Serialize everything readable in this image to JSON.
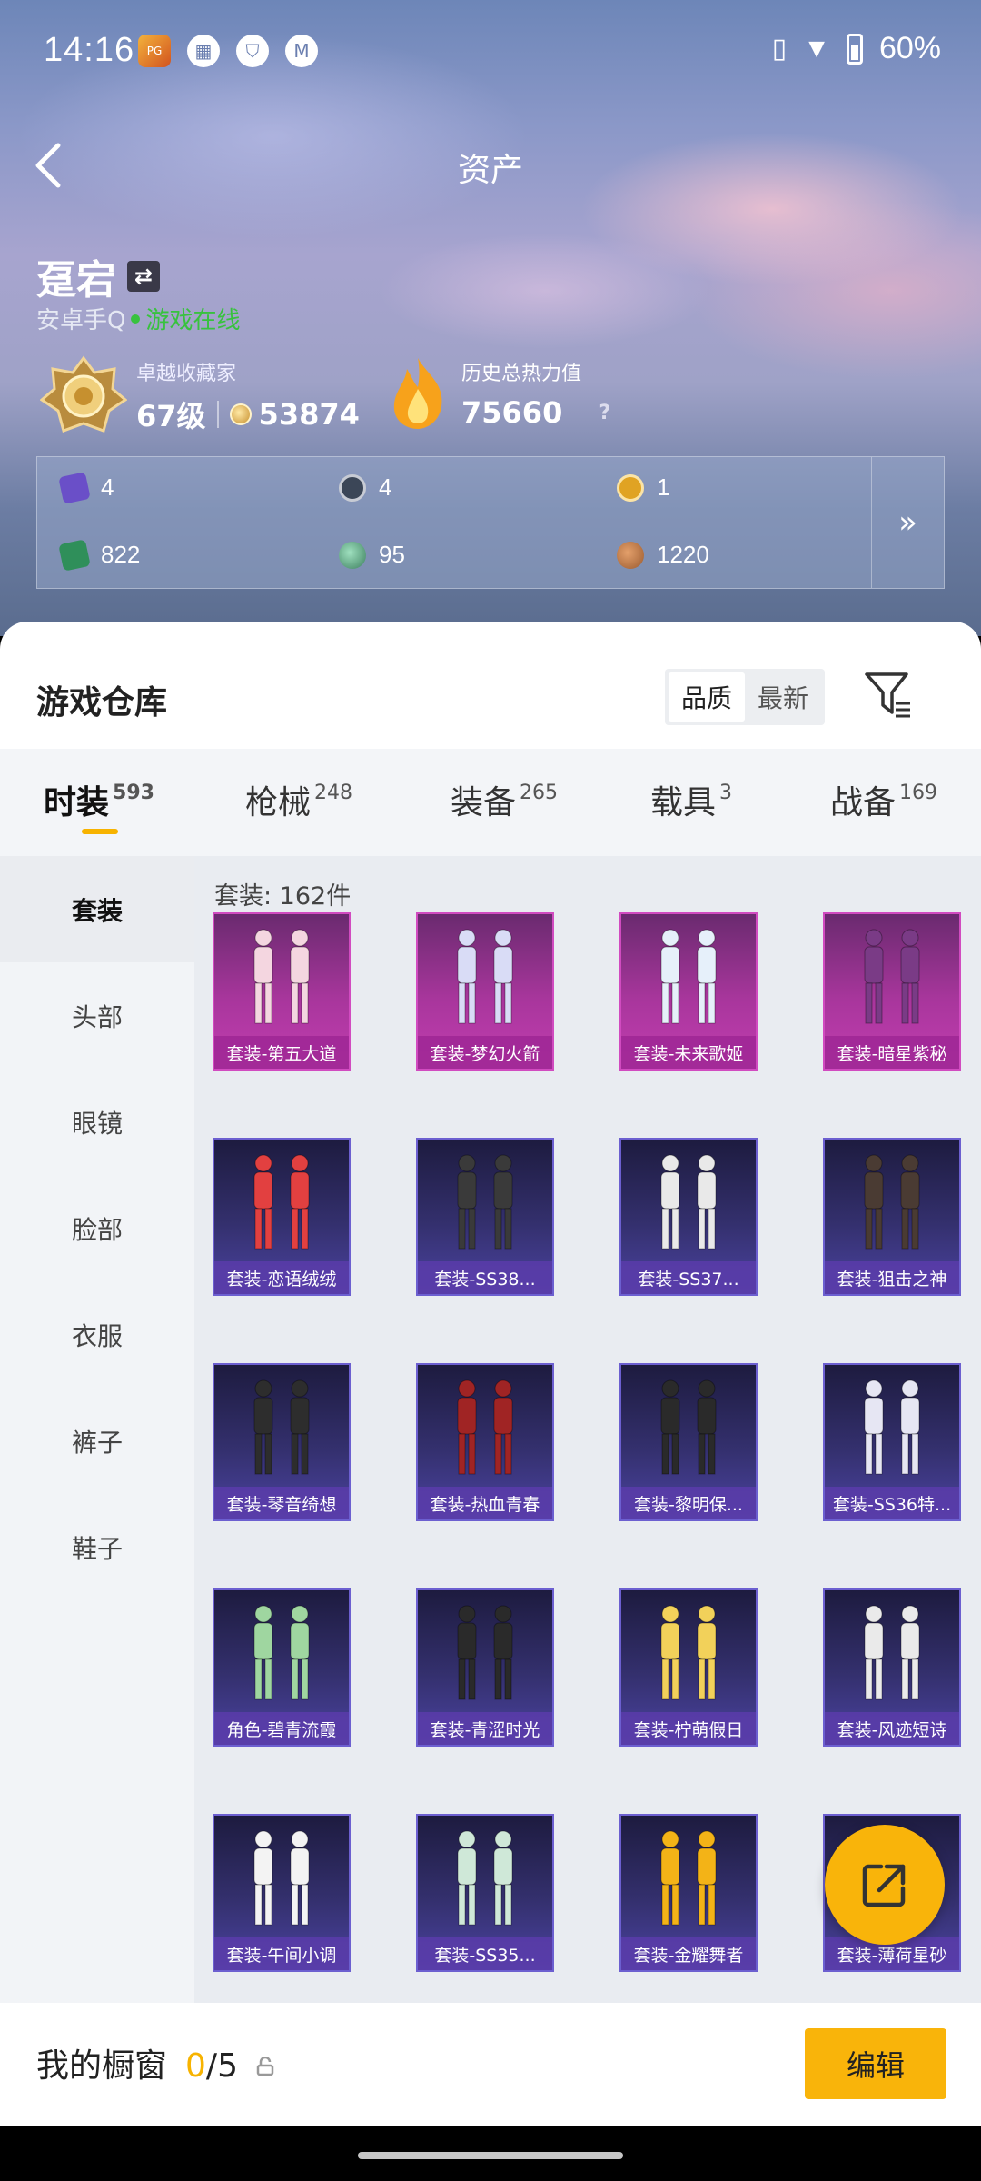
{
  "status_bar": {
    "time": "14:16",
    "battery": "60%",
    "left_icons": [
      "app-icon",
      "calendar-icon",
      "shield-icon",
      "motorola-icon"
    ],
    "right_icons": [
      "vibrate-icon",
      "wifi-icon",
      "battery-icon"
    ]
  },
  "header": {
    "title": "资产"
  },
  "player": {
    "name": "趸宕",
    "platform": "安卓手Q",
    "online": "游戏在线"
  },
  "collector": {
    "label": "卓越收藏家",
    "level": "67级",
    "coins": "53874"
  },
  "heat": {
    "label": "历史总热力值",
    "value": "75660",
    "help": "?"
  },
  "resources": [
    {
      "icon": "purple-card-icon",
      "value": "4",
      "color": "#6a4fc8"
    },
    {
      "icon": "dark-token-icon",
      "value": "4",
      "color": "#3b4657"
    },
    {
      "icon": "gold-token-icon",
      "value": "1",
      "color": "#e0a323"
    },
    {
      "icon": "green-card-icon",
      "value": "822",
      "color": "#2f8f5a"
    },
    {
      "icon": "green-orb-icon",
      "value": "95",
      "color": "#3c7f5e"
    },
    {
      "icon": "bronze-coin-icon",
      "value": "1220",
      "color": "#9a5a2f"
    }
  ],
  "warehouse": {
    "title": "游戏仓库",
    "sort_options": [
      "品质",
      "最新"
    ],
    "tabs": [
      {
        "label": "时装",
        "count": "593"
      },
      {
        "label": "枪械",
        "count": "248"
      },
      {
        "label": "装备",
        "count": "265"
      },
      {
        "label": "载具",
        "count": "3"
      },
      {
        "label": "战备",
        "count": "169"
      }
    ],
    "side_categories": [
      "套装",
      "头部",
      "眼镜",
      "脸部",
      "衣服",
      "裤子",
      "鞋子"
    ],
    "count_text": "套装: 162件",
    "items": [
      {
        "label": "套装-第五大道",
        "tier": "purple"
      },
      {
        "label": "套装-梦幻火箭",
        "tier": "purple"
      },
      {
        "label": "套装-未来歌姬",
        "tier": "purple"
      },
      {
        "label": "套装-暗星紫秘",
        "tier": "purple"
      },
      {
        "label": "套装-恋语绒绒",
        "tier": "blue"
      },
      {
        "label": "套装-SS38...",
        "tier": "blue"
      },
      {
        "label": "套装-SS37...",
        "tier": "blue"
      },
      {
        "label": "套装-狙击之神",
        "tier": "blue"
      },
      {
        "label": "套装-琴音绮想",
        "tier": "blue"
      },
      {
        "label": "套装-热血青春",
        "tier": "blue"
      },
      {
        "label": "套装-黎明保...",
        "tier": "blue"
      },
      {
        "label": "套装-SS36特...",
        "tier": "blue"
      },
      {
        "label": "角色-碧青流霞",
        "tier": "blue"
      },
      {
        "label": "套装-青涩时光",
        "tier": "blue"
      },
      {
        "label": "套装-柠萌假日",
        "tier": "blue"
      },
      {
        "label": "套装-风迹短诗",
        "tier": "blue"
      },
      {
        "label": "套装-午间小调",
        "tier": "blue"
      },
      {
        "label": "套装-SS35...",
        "tier": "blue"
      },
      {
        "label": "套装-金耀舞者",
        "tier": "blue"
      },
      {
        "label": "套装-薄荷星砂",
        "tier": "blue"
      }
    ]
  },
  "showcase": {
    "label": "我的橱窗",
    "current": "0",
    "separator": "/",
    "max": "5",
    "edit_label": "编辑"
  }
}
